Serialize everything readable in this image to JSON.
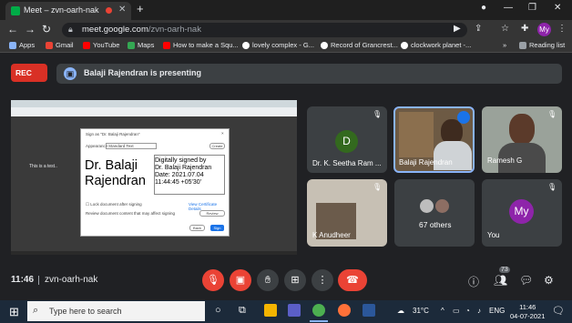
{
  "browser": {
    "tab_title": "Meet – zvn-oarh-nak",
    "url_host": "meet.google.com",
    "url_path": "/zvn-oarh-nak",
    "profile_initials": "My",
    "bookmarks": [
      {
        "label": "Apps",
        "color": "#4285f4"
      },
      {
        "label": "Gmail",
        "color": "#ea4335"
      },
      {
        "label": "YouTube",
        "color": "#ff0000"
      },
      {
        "label": "Maps",
        "color": "#34a853"
      },
      {
        "label": "How to make a Squ...",
        "color": "#ff0000"
      },
      {
        "label": "lovely complex - G...",
        "color": "#ffffff"
      },
      {
        "label": "Record of Grancrest...",
        "color": "#ffffff"
      },
      {
        "label": "clockwork planet -...",
        "color": "#ffffff"
      }
    ],
    "reading_list": "Reading list"
  },
  "meet": {
    "rec_label": "REC",
    "presenting_text": "Balaji Rajendran is presenting",
    "shared_doc": {
      "doc_text": "This is a test..",
      "dialog_title": "Sign as \"Dr. Balaji Rajendran\"",
      "appearance_label": "Appearance",
      "appearance_value": "Standard Text",
      "create_label": "Create",
      "sig_name_line1": "Dr. Balaji",
      "sig_name_line2": "Rajendran",
      "sig_detail_lines": [
        "Digitally signed by",
        "Dr. Balaji Rajendran",
        "Date: 2021.07.04",
        "11:44:45 +05'30'"
      ],
      "lock_label": "Lock document after signing",
      "view_cert_label": "View Certificate Details",
      "review_label": "Review document content that may affect signing",
      "review_button": "Review",
      "back_button": "Back",
      "sign_button": "Sign"
    },
    "tiles": [
      {
        "name": "Dr. K. Seetha Ram ...",
        "initial": "D",
        "avatar_color": "#33691e"
      },
      {
        "name": "Balaji Rajendran"
      },
      {
        "name": "Ramesh G"
      },
      {
        "name": "K Anudheer"
      },
      {
        "name": "67 others"
      },
      {
        "name": "You",
        "initial": "My",
        "avatar_color": "#8e24aa"
      }
    ],
    "time": "11:46",
    "meeting_code": "zvn-oarh-nak",
    "participant_count": "73"
  },
  "taskbar": {
    "search_placeholder": "Type here to search",
    "weather": "31°C",
    "language": "ENG",
    "time": "11:46",
    "date": "04-07-2021"
  }
}
